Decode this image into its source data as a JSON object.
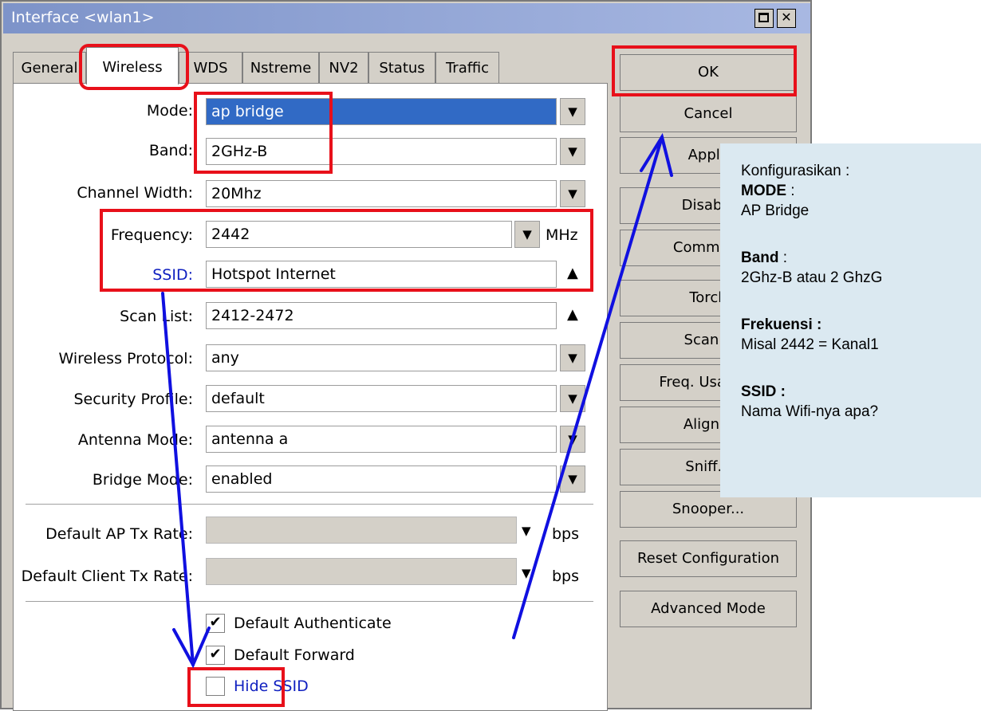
{
  "window": {
    "title": "Interface <wlan1>",
    "maximize_icon": "maximize-icon",
    "close_icon": "close-icon",
    "close_glyph": "✕"
  },
  "tabs": [
    "General",
    "Wireless",
    "WDS",
    "Nstreme",
    "NV2",
    "Status",
    "Traffic"
  ],
  "active_tab": "Wireless",
  "fields": {
    "mode": {
      "label": "Mode:",
      "value": "ap bridge"
    },
    "band": {
      "label": "Band:",
      "value": "2GHz-B"
    },
    "channel_width": {
      "label": "Channel Width:",
      "value": "20Mhz"
    },
    "frequency": {
      "label": "Frequency:",
      "value": "2442",
      "unit": "MHz"
    },
    "ssid": {
      "label": "SSID:",
      "value": "Hotspot Internet"
    },
    "scan_list": {
      "label": "Scan List:",
      "value": "2412-2472"
    },
    "wireless_protocol": {
      "label": "Wireless Protocol:",
      "value": "any"
    },
    "security_profile": {
      "label": "Security Profile:",
      "value": "default"
    },
    "antenna_mode": {
      "label": "Antenna Mode:",
      "value": "antenna a"
    },
    "bridge_mode": {
      "label": "Bridge Mode:",
      "value": "enabled"
    },
    "default_ap_tx_rate": {
      "label": "Default AP Tx Rate:",
      "value": "",
      "unit": "bps"
    },
    "default_client_tx_rate": {
      "label": "Default Client Tx Rate:",
      "value": "",
      "unit": "bps"
    }
  },
  "checkboxes": {
    "default_authenticate": {
      "label": "Default Authenticate",
      "checked": true
    },
    "default_forward": {
      "label": "Default Forward",
      "checked": true
    },
    "hide_ssid": {
      "label": "Hide SSID",
      "checked": false
    }
  },
  "glyphs": {
    "dropdown": "▼",
    "dropdown_bar": "▼",
    "scroll_up": "▲",
    "check": "✔"
  },
  "buttons": [
    "OK",
    "Cancel",
    "Apply",
    "Disable",
    "Comment",
    "Torch",
    "Scan...",
    "Freq. Usage...",
    "Align...",
    "Sniff...",
    "Snooper...",
    "Reset Configuration",
    "Advanced Mode"
  ],
  "annotation": {
    "heading": "Konfigurasikan :",
    "items": [
      {
        "title": "MODE",
        "sep": " :",
        "value": "AP Bridge"
      },
      {
        "title": "Band",
        "sep": " :",
        "value": "2Ghz-B atau 2 GhzG"
      },
      {
        "title": "Frekuensi :",
        "sep": "",
        "value": "Misal 2442 = Kanal1"
      },
      {
        "title": "SSID :",
        "sep": "",
        "value": "Nama Wifi-nya apa?"
      }
    ],
    "highlight_color": "#e8101a",
    "arrow_color": "#1010e0",
    "note_background": "#dbe9f1"
  }
}
